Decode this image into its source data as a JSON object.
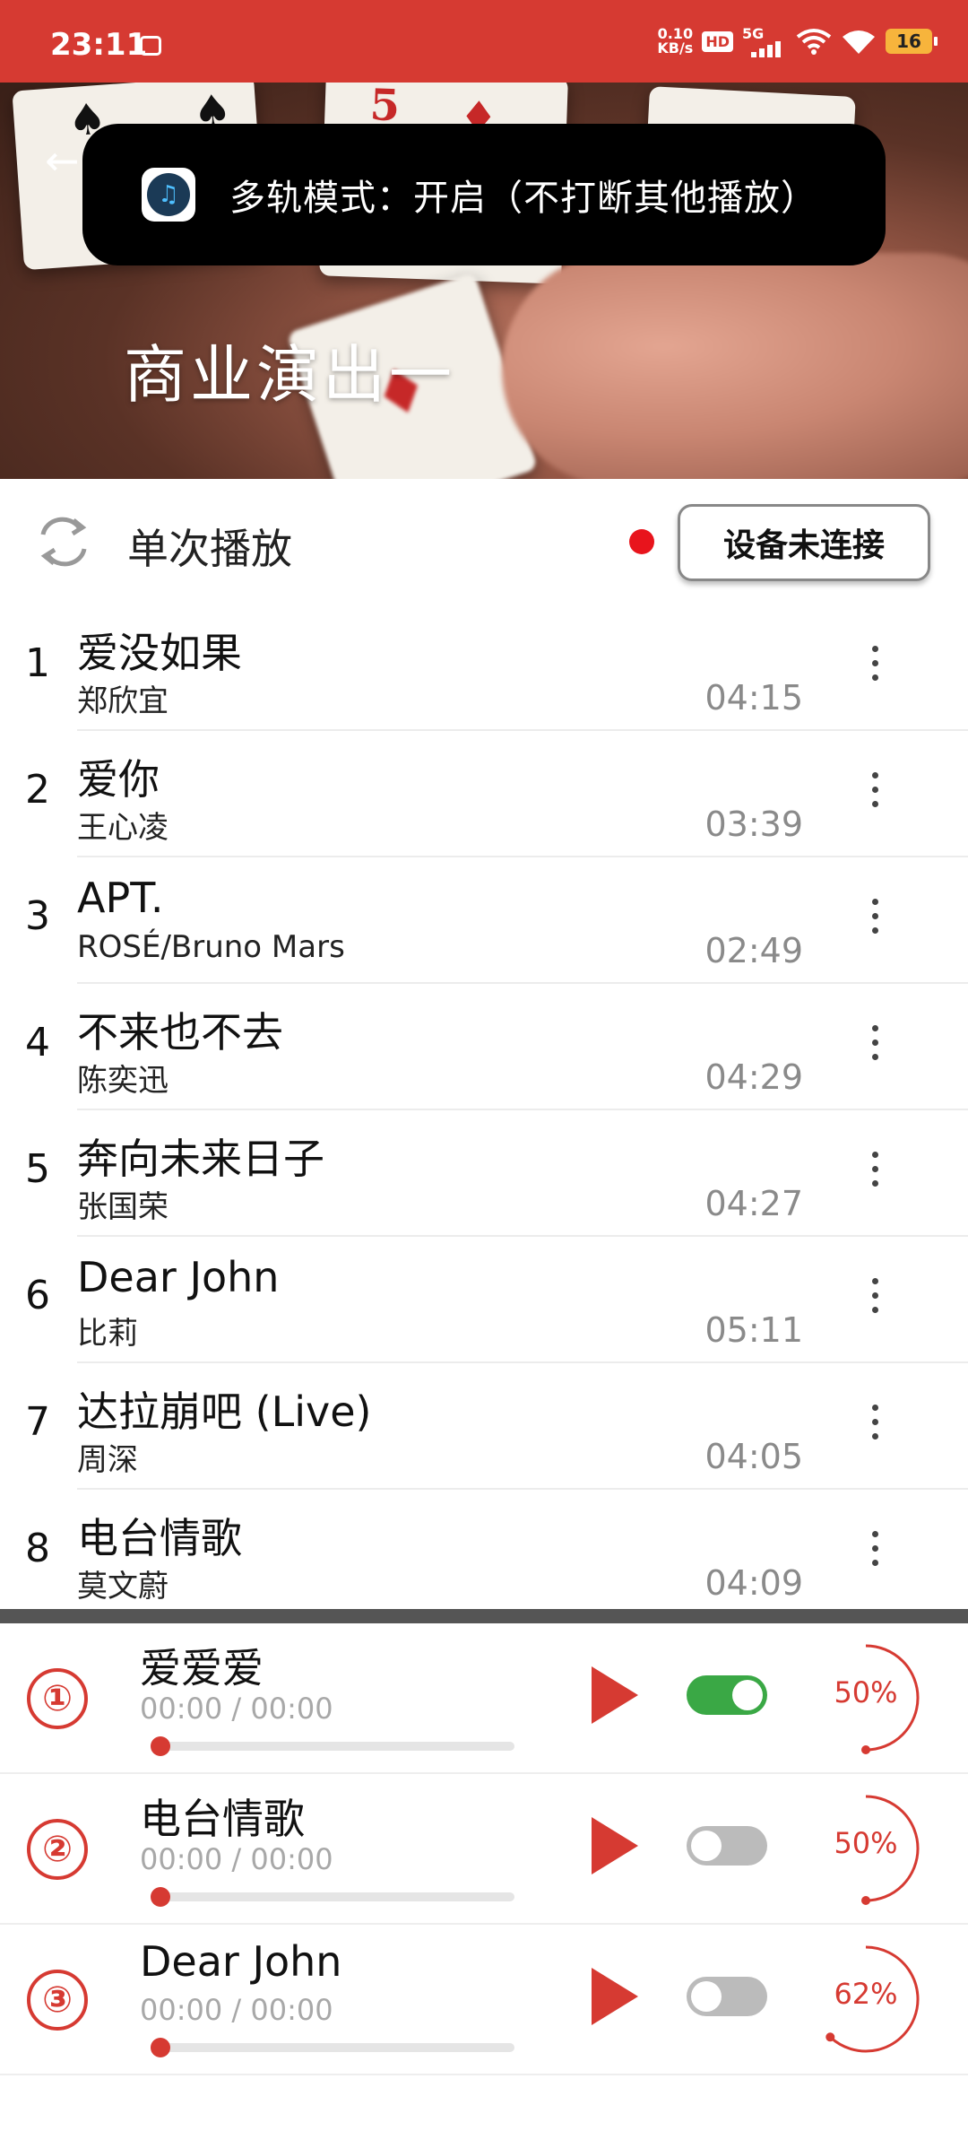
{
  "status_bar": {
    "time": "23:11",
    "net_speed_value": "0.10",
    "net_speed_unit": "KB/s",
    "hd": "HD",
    "network": "5G",
    "battery": "16"
  },
  "hero": {
    "title": "商业演出一"
  },
  "toast": {
    "text": "多轨模式：开启（不打断其他播放）"
  },
  "controls": {
    "play_mode": "单次播放",
    "device_button": "设备未连接",
    "status_dot_color": "#e8141c"
  },
  "songs": [
    {
      "index": "1",
      "title": "爱没如果",
      "artist": "郑欣宜",
      "duration": "04:15"
    },
    {
      "index": "2",
      "title": "爱你",
      "artist": "王心凌",
      "duration": "03:39"
    },
    {
      "index": "3",
      "title": "APT.",
      "artist": "ROSÉ/Bruno Mars",
      "duration": "02:49"
    },
    {
      "index": "4",
      "title": "不来也不去",
      "artist": "陈奕迅",
      "duration": "04:29"
    },
    {
      "index": "5",
      "title": "奔向未来日子",
      "artist": "张国荣",
      "duration": "04:27"
    },
    {
      "index": "6",
      "title": "Dear John",
      "artist": "比莉",
      "duration": "05:11"
    },
    {
      "index": "7",
      "title": "达拉崩吧 (Live)",
      "artist": "周深",
      "duration": "04:05"
    },
    {
      "index": "8",
      "title": "电台情歌",
      "artist": "莫文蔚",
      "duration": "04:09"
    }
  ],
  "tracks": [
    {
      "number": "①",
      "title": "爱爱爱",
      "time": "00:00 / 00:00",
      "progress": 0,
      "enabled": true,
      "volume_label": "50%",
      "volume": 0.5
    },
    {
      "number": "②",
      "title": "电台情歌",
      "time": "00:00 / 00:00",
      "progress": 0,
      "enabled": false,
      "volume_label": "50%",
      "volume": 0.5
    },
    {
      "number": "③",
      "title": "Dear John",
      "time": "00:00 / 00:00",
      "progress": 0,
      "enabled": false,
      "volume_label": "62%",
      "volume": 0.62
    }
  ],
  "colors": {
    "accent": "#d63a32",
    "toggle_on": "#3aa845",
    "toggle_off": "#bbbbbb"
  }
}
